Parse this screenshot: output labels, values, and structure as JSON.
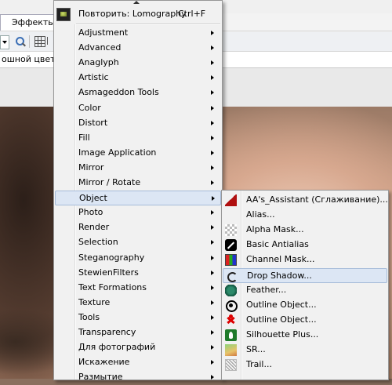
{
  "app": {
    "tab_effects": "Эффекты",
    "background_color_label": "ошной цвет"
  },
  "menu": {
    "repeat_label": "Повторить: Lomography",
    "repeat_shortcut": "Ctrl+F",
    "items": [
      {
        "label": "Adjustment"
      },
      {
        "label": "Advanced"
      },
      {
        "label": "Anaglyph"
      },
      {
        "label": "Artistic"
      },
      {
        "label": "Asmageddon Tools"
      },
      {
        "label": "Color"
      },
      {
        "label": "Distort"
      },
      {
        "label": "Fill"
      },
      {
        "label": "Image Application"
      },
      {
        "label": "Mirror"
      },
      {
        "label": "Mirror / Rotate"
      },
      {
        "label": "Object"
      },
      {
        "label": "Photo"
      },
      {
        "label": "Render"
      },
      {
        "label": "Selection"
      },
      {
        "label": "Steganography"
      },
      {
        "label": "StewienFilters"
      },
      {
        "label": "Text Formations"
      },
      {
        "label": "Texture"
      },
      {
        "label": "Tools"
      },
      {
        "label": "Transparency"
      },
      {
        "label": "Для фотографий"
      },
      {
        "label": "Искажение"
      },
      {
        "label": "Размытие"
      }
    ],
    "highlighted_index": 11
  },
  "submenu": {
    "items": [
      {
        "label": "AA's_Assistant (Сглаживание)...",
        "icon": "aa-assistant-icon"
      },
      {
        "label": "Alias...",
        "icon": "blank-icon"
      },
      {
        "label": "Alpha Mask...",
        "icon": "checker-icon"
      },
      {
        "label": "Basic Antialias",
        "icon": "diagonal-line-icon"
      },
      {
        "label": "Channel Mask...",
        "icon": "rgb-channels-icon"
      },
      {
        "label": "Drop Shadow...",
        "icon": "shadow-swirl-icon"
      },
      {
        "label": "Feather...",
        "icon": "feather-icon"
      },
      {
        "label": "Outline Object...",
        "icon": "target-circle-icon"
      },
      {
        "label": "Outline Object...",
        "icon": "red-figure-icon"
      },
      {
        "label": "Silhouette Plus...",
        "icon": "silhouette-icon"
      },
      {
        "label": "SR...",
        "icon": "sr-icon"
      },
      {
        "label": "Trail...",
        "icon": "trail-icon"
      }
    ],
    "highlighted_index": 5
  }
}
